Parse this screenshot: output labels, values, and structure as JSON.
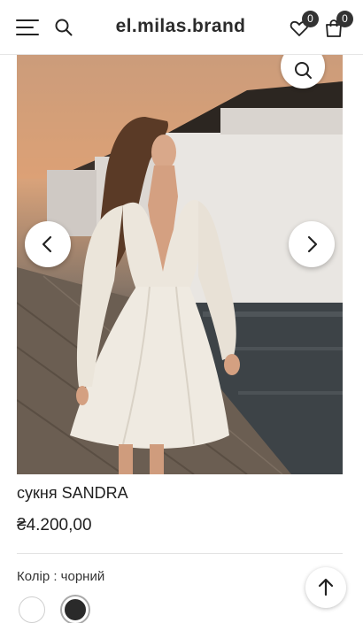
{
  "header": {
    "logo": "el.milas.brand",
    "wishlist_count": "0",
    "cart_count": "0"
  },
  "product": {
    "title": "сукня SANDRA",
    "price": "₴4.200,00",
    "color_label": "Колір : чорний",
    "swatches": [
      "white",
      "black"
    ],
    "selected_swatch": "black"
  },
  "colors": {
    "accent": "#2b2b2b",
    "badge": "#333333",
    "divider": "#e3e3e3"
  },
  "icons": {
    "menu": "hamburger-icon",
    "search": "search-icon",
    "wishlist": "heart-icon",
    "cart": "bag-icon",
    "zoom": "zoom-icon",
    "prev": "chevron-left-icon",
    "next": "chevron-right-icon",
    "top": "arrow-up-icon"
  }
}
